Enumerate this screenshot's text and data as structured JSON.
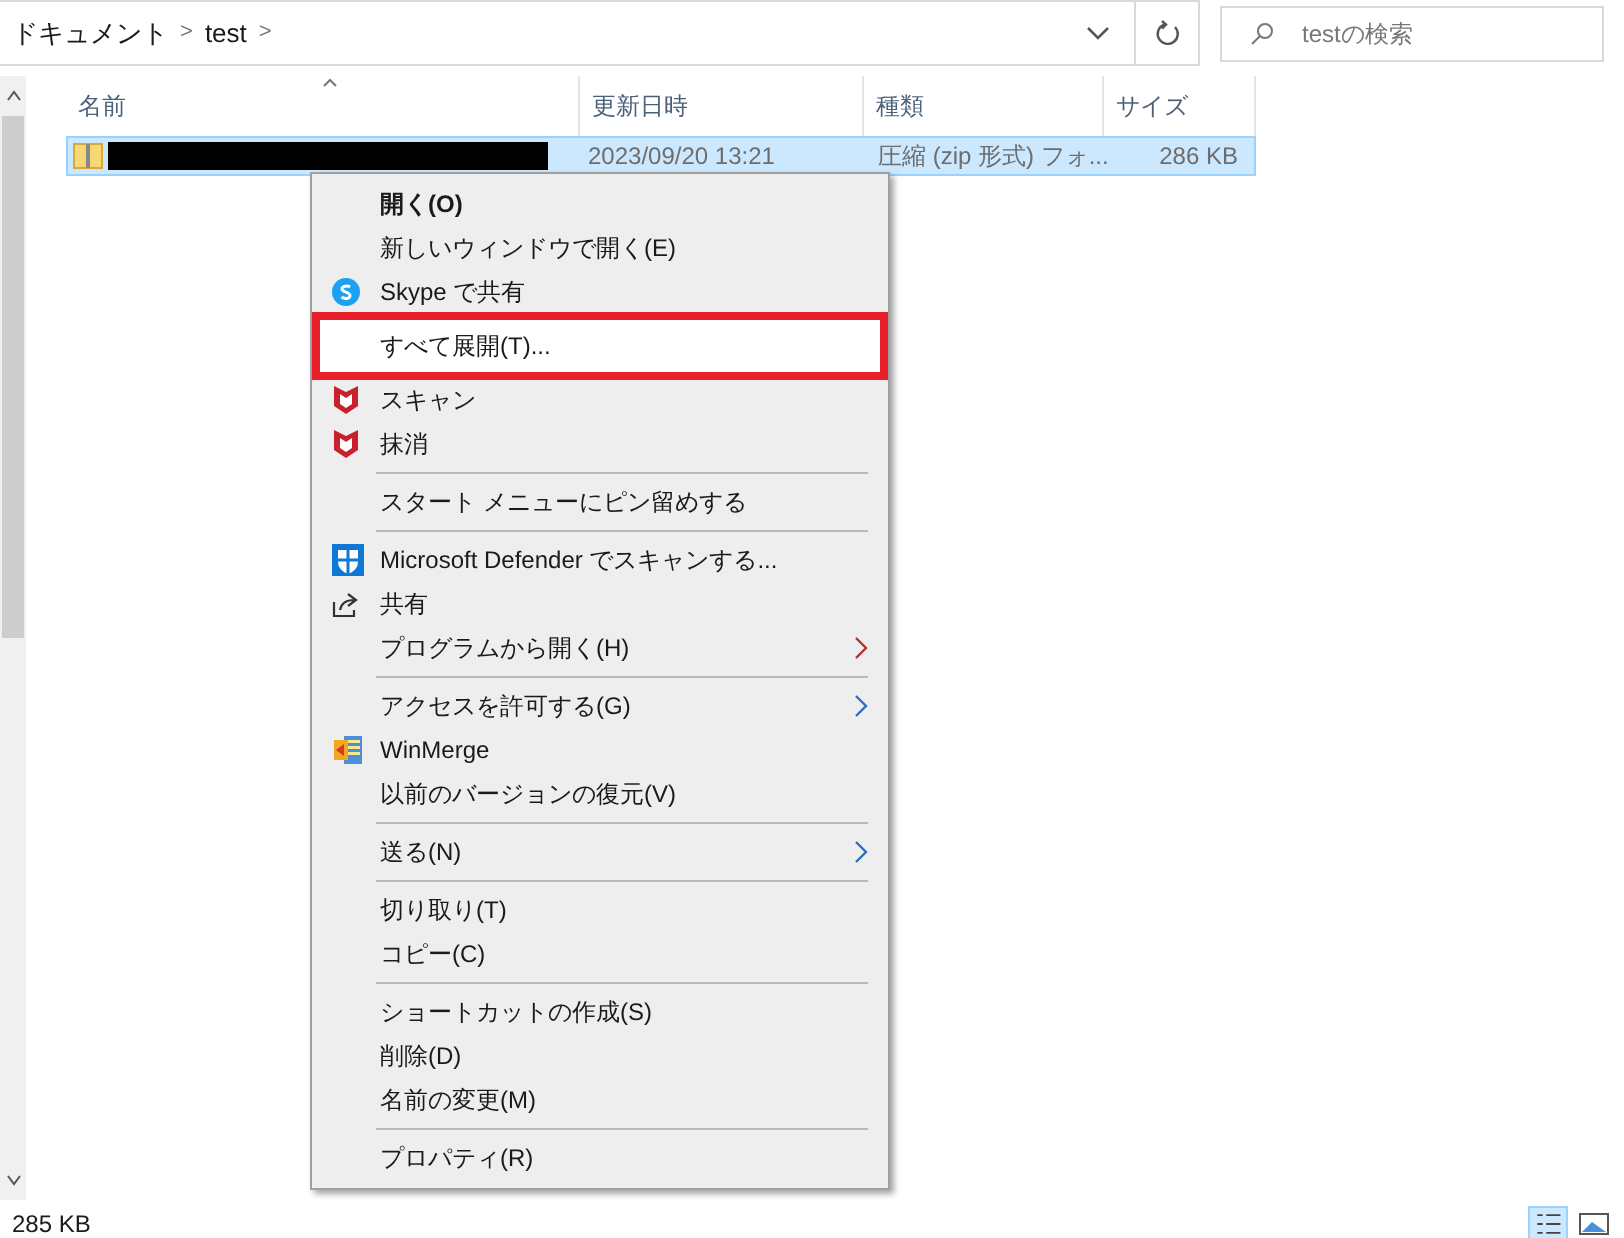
{
  "address_bar": {
    "breadcrumbs": [
      "ドキュメント",
      "test"
    ],
    "separators": [
      ">",
      ">"
    ]
  },
  "search": {
    "placeholder": "testの検索"
  },
  "columns": [
    {
      "label": "名前",
      "sorted": true
    },
    {
      "label": "更新日時",
      "sorted": false
    },
    {
      "label": "種類",
      "sorted": false
    },
    {
      "label": "サイズ",
      "sorted": false
    }
  ],
  "rows": [
    {
      "modified": "2023/09/20 13:21",
      "type": "圧縮 (zip 形式) フォ...",
      "size": "286 KB",
      "selected": true
    }
  ],
  "context_menu": [
    {
      "kind": "item",
      "label": "開く(O)",
      "bold": true,
      "highlighted": false
    },
    {
      "kind": "item",
      "label": "新しいウィンドウで開く(E)",
      "bold": false,
      "highlighted": false
    },
    {
      "kind": "item",
      "label": "Skype で共有",
      "bold": false,
      "highlighted": false
    },
    {
      "kind": "item",
      "label": "すべて展開(T)...",
      "bold": false,
      "highlighted": true
    },
    {
      "kind": "item",
      "label": "スキャン",
      "bold": false,
      "highlighted": false
    },
    {
      "kind": "item",
      "label": "抹消",
      "bold": false,
      "highlighted": false
    },
    {
      "kind": "separator"
    },
    {
      "kind": "item",
      "label": "スタート メニューにピン留めする",
      "bold": false,
      "highlighted": false
    },
    {
      "kind": "separator"
    },
    {
      "kind": "item",
      "label": "Microsoft Defender でスキャンする...",
      "bold": false,
      "highlighted": false
    },
    {
      "kind": "item",
      "label": "共有",
      "bold": false,
      "highlighted": false
    },
    {
      "kind": "item",
      "label": "プログラムから開く(H)",
      "submenu": true,
      "bold": false,
      "highlighted": false
    },
    {
      "kind": "separator"
    },
    {
      "kind": "item",
      "label": "アクセスを許可する(G)",
      "submenu": true,
      "bold": false,
      "highlighted": false
    },
    {
      "kind": "item",
      "label": "WinMerge",
      "bold": false,
      "highlighted": false
    },
    {
      "kind": "item",
      "label": "以前のバージョンの復元(V)",
      "bold": false,
      "highlighted": false
    },
    {
      "kind": "separator"
    },
    {
      "kind": "item",
      "label": "送る(N)",
      "submenu": true,
      "bold": false,
      "highlighted": false
    },
    {
      "kind": "separator"
    },
    {
      "kind": "item",
      "label": "切り取り(T)",
      "bold": false,
      "highlighted": false
    },
    {
      "kind": "item",
      "label": "コピー(C)",
      "bold": false,
      "highlighted": false
    },
    {
      "kind": "separator"
    },
    {
      "kind": "item",
      "label": "ショートカットの作成(S)",
      "bold": false,
      "highlighted": false
    },
    {
      "kind": "item",
      "label": "削除(D)",
      "bold": false,
      "highlighted": false
    },
    {
      "kind": "item",
      "label": "名前の変更(M)",
      "bold": false,
      "highlighted": false
    },
    {
      "kind": "separator"
    },
    {
      "kind": "item",
      "label": "プロパティ(R)",
      "bold": false,
      "highlighted": false
    }
  ],
  "status_bar": {
    "text": "285 KB"
  }
}
